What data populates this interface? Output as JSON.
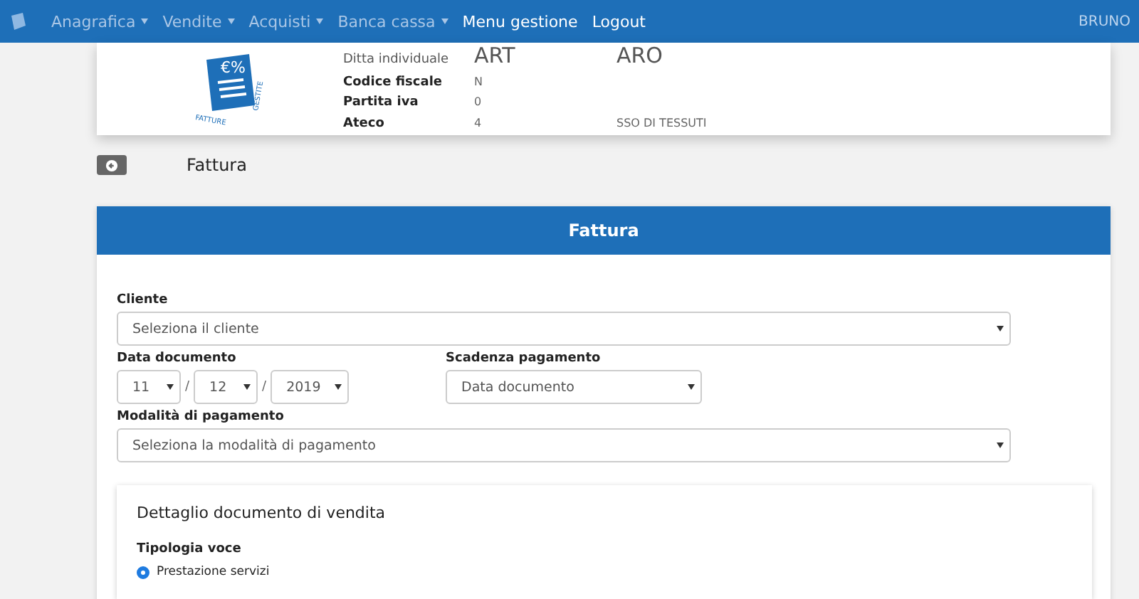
{
  "navbar": {
    "items": [
      {
        "label": "Anagrafica",
        "kind": "dropdown"
      },
      {
        "label": "Vendite",
        "kind": "dropdown"
      },
      {
        "label": "Acquisti",
        "kind": "dropdown"
      },
      {
        "label": "Banca cassa",
        "kind": "dropdown"
      },
      {
        "label": "Menu gestione",
        "kind": "link"
      },
      {
        "label": "Logout",
        "kind": "link"
      }
    ],
    "user": "BRUNO"
  },
  "company": {
    "logo_symbol": "€%",
    "logo_text": "FATTURE",
    "logo_text_2": "GESTITE",
    "type_label": "Ditta individuale",
    "name_start": "ART",
    "name_end": "ARO",
    "fields": [
      {
        "label": "Codice fiscale",
        "value": "N"
      },
      {
        "label": "Partita iva",
        "value": "0"
      },
      {
        "label": "Ateco",
        "value": "4",
        "value_end": "SSO DI TESSUTI"
      }
    ]
  },
  "page_title": "Fattura",
  "form": {
    "title": "Fattura",
    "cliente": {
      "label": "Cliente",
      "placeholder": "Seleziona il cliente"
    },
    "data_documento": {
      "label": "Data documento",
      "day": "11",
      "separator_1": "/",
      "month": "12",
      "separator_2": "/",
      "year": "2019"
    },
    "scadenza": {
      "label": "Scadenza pagamento",
      "value": "Data documento"
    },
    "modalita": {
      "label": "Modalità di pagamento",
      "placeholder": "Seleziona la modalità di pagamento"
    },
    "detail": {
      "title": "Dettaglio documento di vendita",
      "tipologia_label": "Tipologia voce",
      "options": [
        {
          "label": "Prestazione servizi",
          "selected": true
        }
      ]
    }
  }
}
